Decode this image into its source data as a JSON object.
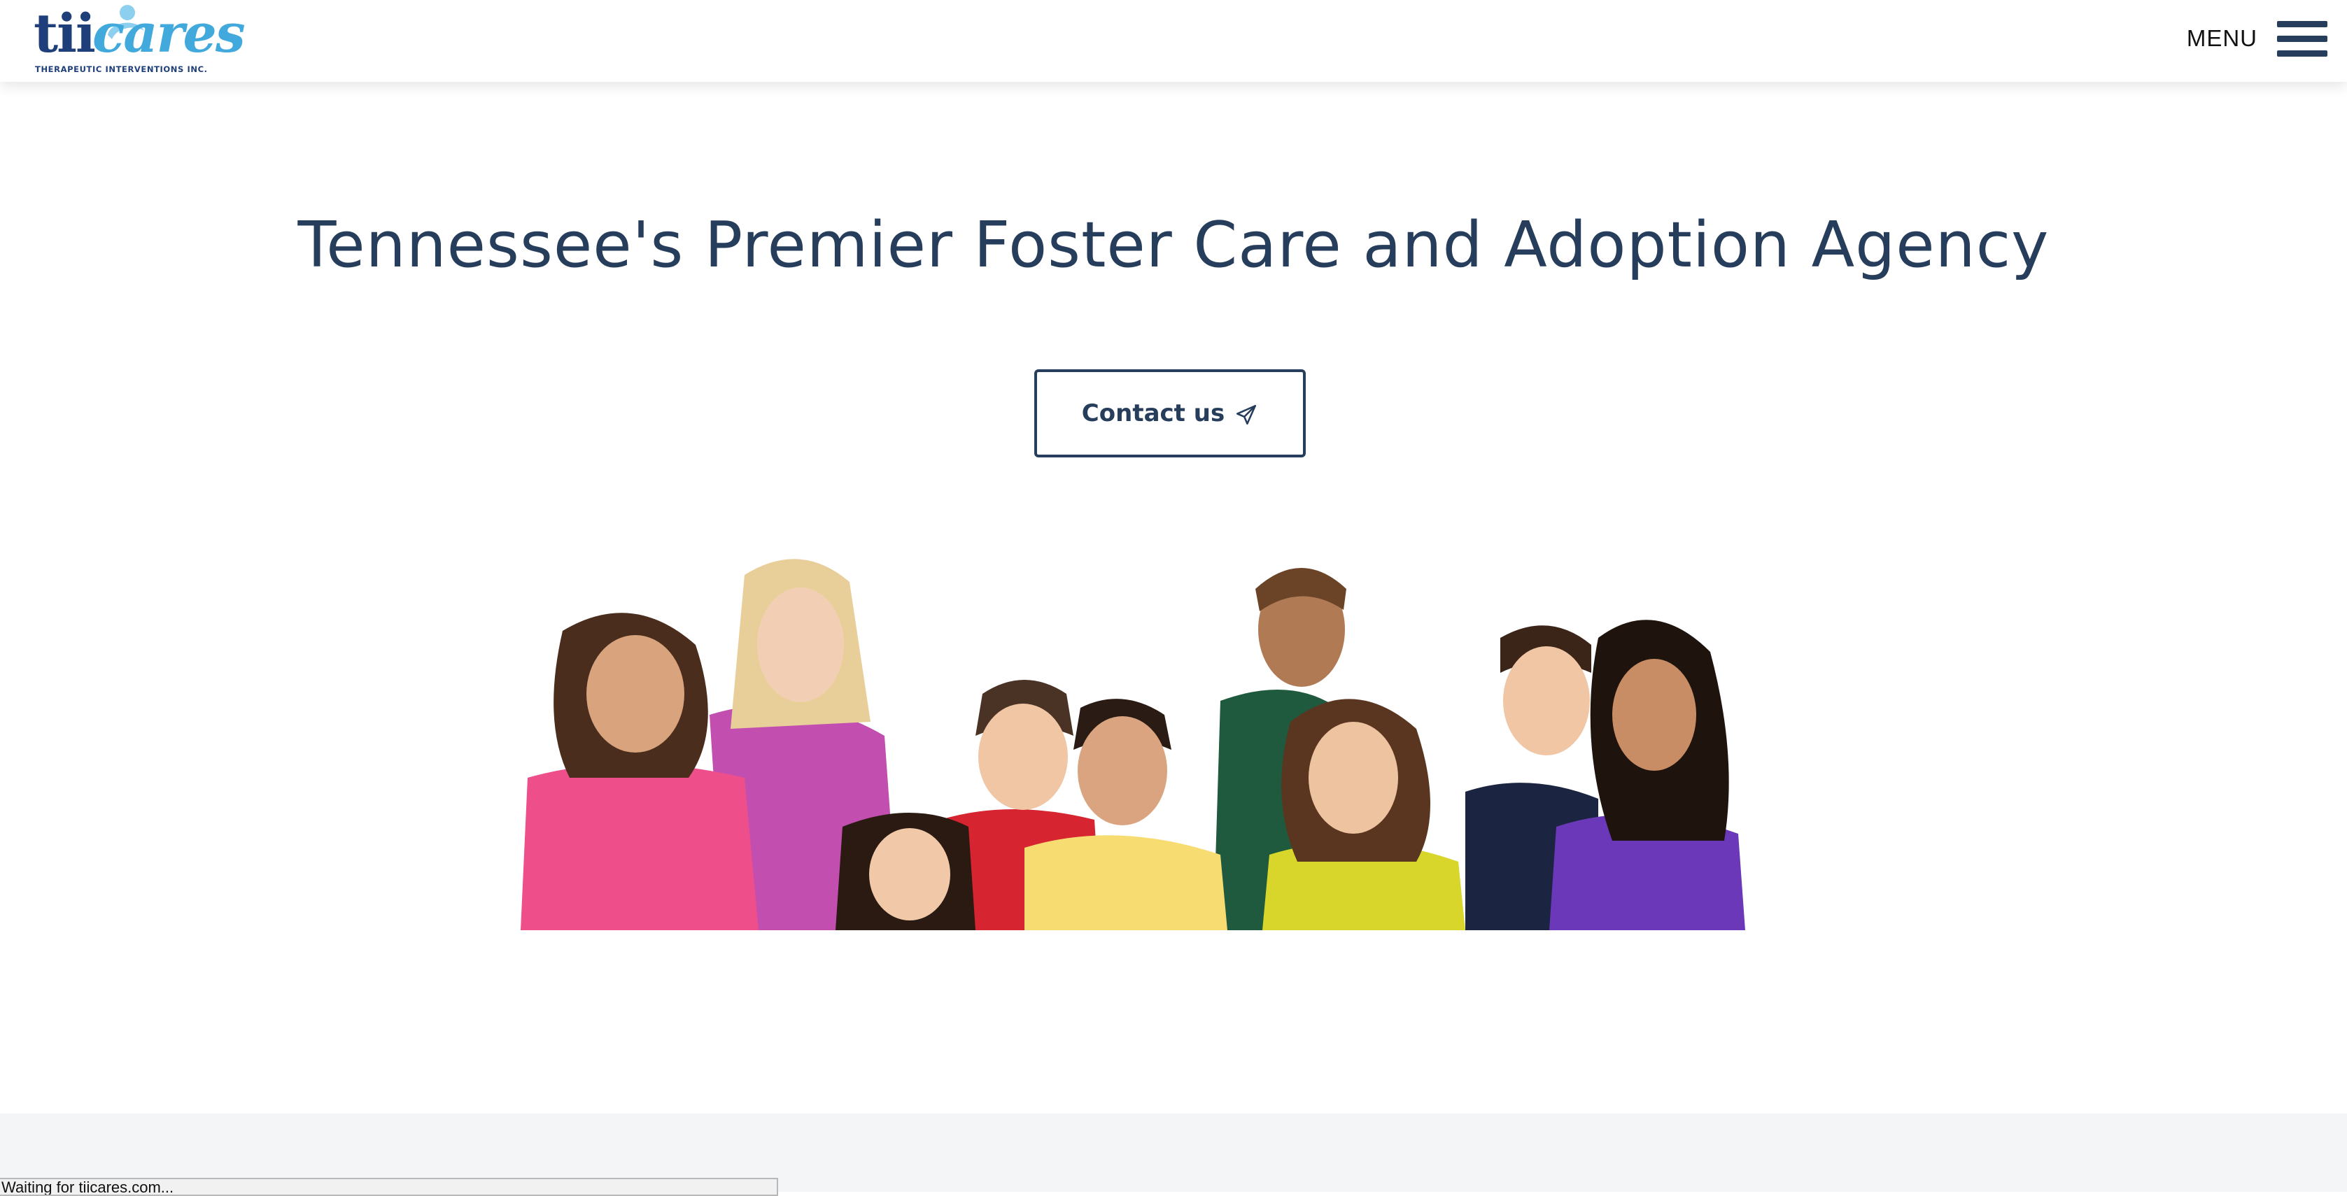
{
  "header": {
    "logo": {
      "word_tii": "tii",
      "word_cares": "cares",
      "tagline": "THERAPEUTIC INTERVENTIONS INC."
    },
    "menu_label": "MENU",
    "menu_icon": "hamburger-menu-icon"
  },
  "hero": {
    "title": "Tennessee's Premier Foster Care and Adoption Agency",
    "contact_button": {
      "label": "Contact us",
      "icon": "paper-plane-icon"
    }
  },
  "status_bar": {
    "text": "Waiting for tiicares.com..."
  },
  "colors": {
    "primary": "#263d5c",
    "logo_dark": "#1f3f7a",
    "logo_light": "#41a9dc",
    "footer_band": "#f4f5f7"
  }
}
